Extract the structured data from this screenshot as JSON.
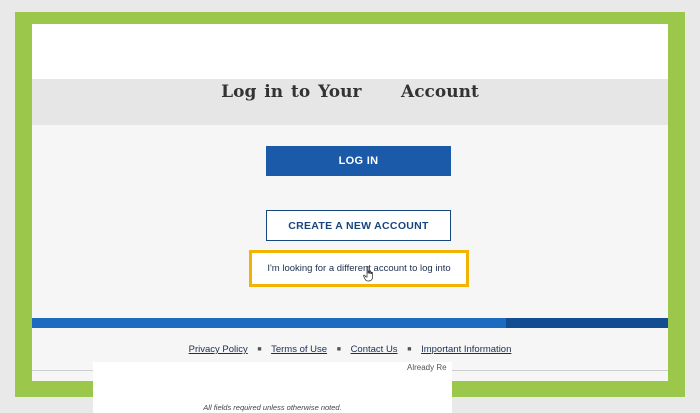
{
  "page": {
    "title": "Log in to Your     Account"
  },
  "buttons": {
    "login_label": "LOG IN",
    "create_label": "CREATE A NEW ACCOUNT"
  },
  "links": {
    "different_account": "I'm looking for a different account to log into"
  },
  "footer": {
    "privacy": "Privacy Policy",
    "terms": "Terms of Use",
    "contact": "Contact Us",
    "important": "Important Information",
    "separator": "■"
  },
  "overlay": {
    "already": "Already Re",
    "fields_note": "All fields required unless otherwise noted."
  },
  "colors": {
    "frame_green": "#9bc84a",
    "primary_blue": "#1a5aa8",
    "highlight_yellow": "#f2b400"
  },
  "icons": {
    "cursor": "hand-pointer-icon"
  }
}
